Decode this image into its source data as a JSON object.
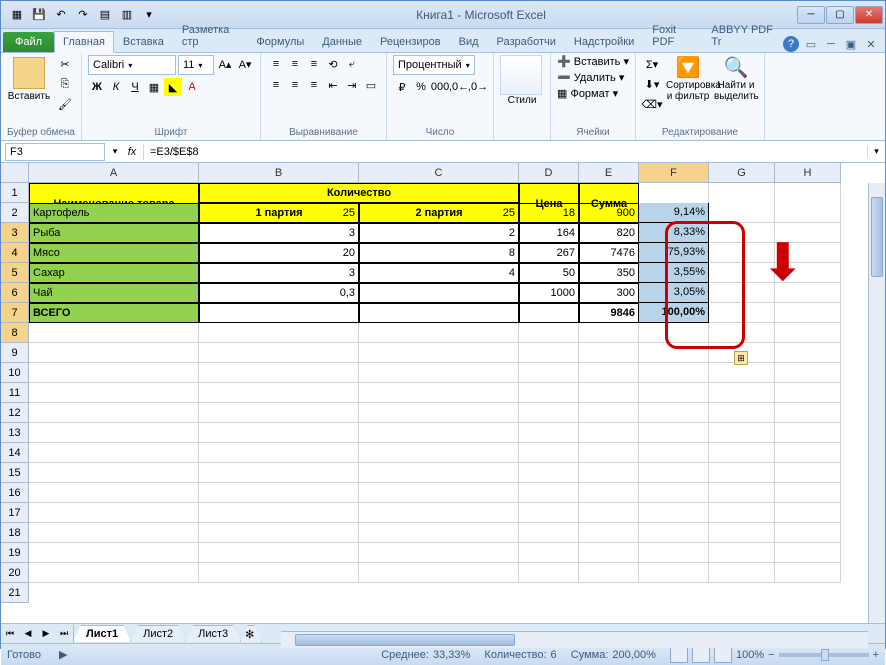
{
  "title": "Книга1 - Microsoft Excel",
  "tabs": {
    "file": "Файл",
    "home": "Главная",
    "insert": "Вставка",
    "layout": "Разметка стр",
    "formulas": "Формулы",
    "data": "Данные",
    "review": "Рецензиров",
    "view": "Вид",
    "developer": "Разработчи",
    "addins": "Надстройки",
    "foxit": "Foxit PDF",
    "abbyy": "ABBYY PDF Tr"
  },
  "ribbon": {
    "clipboard": {
      "paste": "Вставить",
      "label": "Буфер обмена"
    },
    "font": {
      "name": "Calibri",
      "size": "11",
      "label": "Шрифт"
    },
    "alignment": {
      "label": "Выравнивание"
    },
    "number": {
      "format": "Процентный",
      "label": "Число"
    },
    "styles": {
      "label": "Стили"
    },
    "cells": {
      "insert": "Вставить",
      "delete": "Удалить",
      "format": "Формат",
      "label": "Ячейки"
    },
    "editing": {
      "sort": "Сортировка и фильтр",
      "find": "Найти и выделить",
      "label": "Редактирование"
    }
  },
  "namebox": "F3",
  "formula": "=E3/$E$8",
  "cols": [
    "A",
    "B",
    "C",
    "D",
    "E",
    "F",
    "G",
    "H"
  ],
  "table": {
    "h_name": "Наименование товара",
    "h_qty": "Количество",
    "h_p1": "1 партия",
    "h_p2": "2 партия",
    "h_price": "Цена",
    "h_sum": "Сумма",
    "rows": [
      {
        "name": "Картофель",
        "p1": "25",
        "p2": "25",
        "price": "18",
        "sum": "900",
        "pct": "9,14%"
      },
      {
        "name": "Рыба",
        "p1": "3",
        "p2": "2",
        "price": "164",
        "sum": "820",
        "pct": "8,33%"
      },
      {
        "name": "Мясо",
        "p1": "20",
        "p2": "8",
        "price": "267",
        "sum": "7476",
        "pct": "75,93%"
      },
      {
        "name": "Сахар",
        "p1": "3",
        "p2": "4",
        "price": "50",
        "sum": "350",
        "pct": "3,55%"
      },
      {
        "name": "Чай",
        "p1": "0,3",
        "p2": "",
        "price": "1000",
        "sum": "300",
        "pct": "3,05%"
      }
    ],
    "total": {
      "name": "ВСЕГО",
      "sum": "9846",
      "pct": "100,00%"
    }
  },
  "sheets": [
    "Лист1",
    "Лист2",
    "Лист3"
  ],
  "status": {
    "ready": "Готово",
    "avg_l": "Среднее:",
    "avg": "33,33%",
    "cnt_l": "Количество:",
    "cnt": "6",
    "sum_l": "Сумма:",
    "sum": "200,00%",
    "zoom": "100%"
  }
}
